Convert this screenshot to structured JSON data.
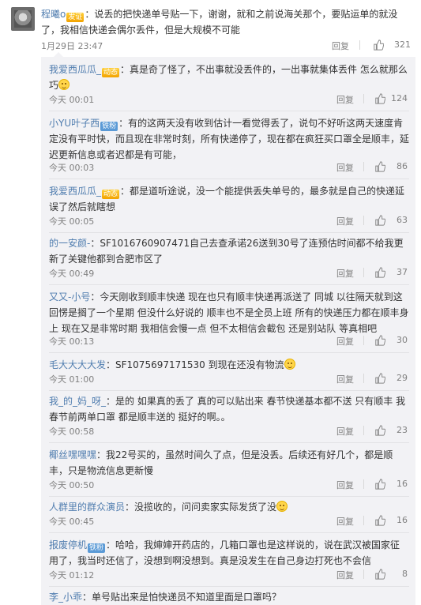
{
  "main_comment": {
    "username": "程曦o",
    "badge": "发证",
    "text": "：说丢的把快递单号贴一下，谢谢，就和之前说海关那个，要贴运单的就没了，我相信快递会偶尔丢件，但是大规模不可能",
    "time": "1月29日 23:47",
    "reply_label": "回复",
    "likes": "321"
  },
  "replies": [
    {
      "username": "我爱西瓜瓜_",
      "badge": "动态",
      "badge_type": "gold",
      "text": "：真是奇了怪了，不出事就没丢件的，一出事就集体丢件 怎么就那么巧",
      "emoji": true,
      "time": "今天 00:01",
      "reply_label": "回复",
      "likes": "124"
    },
    {
      "username": "小YU叶子西",
      "badge": "铁粉",
      "badge_type": "blue",
      "text": "：有的这两天没有收到估计一看觉得丢了，说句不好听这两天速度肯定没有平时快，而且现在非常时刻，所有快递停了，现在都在疯狂买口罩全是顺丰，延迟更新信息或者迟都是有可能，",
      "emoji": false,
      "time": "今天 00:03",
      "reply_label": "回复",
      "likes": "86"
    },
    {
      "username": "我爱西瓜瓜_",
      "badge": "动态",
      "badge_type": "gold",
      "text": "：都是道听途说，没一个能提供丢失单号的，最多就是自己的快递延误了然后就瞎想",
      "emoji": false,
      "time": "今天 00:05",
      "reply_label": "回复",
      "likes": "63"
    },
    {
      "username": "的一安颜-",
      "badge": "",
      "badge_type": "",
      "text": "：SF1016760907471自己去查承诺26送到30号了连预估时间都不给我更新了关键他都到合肥市区了",
      "emoji": false,
      "time": "今天 00:49",
      "reply_label": "回复",
      "likes": "37"
    },
    {
      "username": "又又-小号",
      "badge": "",
      "badge_type": "",
      "text": "：今天刚收到顺丰快递 现在也只有顺丰快递再派送了 同城 以往隔天就到这回愣是搁了一个星期 但没什么好说的 顺丰也不是全员上班 所有的快递压力都在顺丰身上 现在又是非常时期 我相信会慢一点 但不太相信会截包 还是别站队 等真相吧",
      "emoji": false,
      "time": "今天 00:13",
      "reply_label": "回复",
      "likes": "30"
    },
    {
      "username": "毛大大大大发",
      "badge": "",
      "badge_type": "",
      "text": "：SF1075697171530 到现在还没有物流",
      "emoji": true,
      "time": "今天 01:00",
      "reply_label": "回复",
      "likes": "29"
    },
    {
      "username": "我_的_妈_呀_",
      "badge": "",
      "badge_type": "",
      "text": "：是的 如果真的丢了 真的可以贴出来 春节快递基本都不送 只有顺丰 我春节前两单口罩 都是顺丰送的 挺好的啊。。",
      "emoji": false,
      "time": "今天 00:58",
      "reply_label": "回复",
      "likes": "23"
    },
    {
      "username": "椰丝嘿嘿嘿",
      "badge": "",
      "badge_type": "",
      "text": "：我22号买的，虽然时间久了点，但是没丢。后续还有好几个，都是顺丰，只是物流信息更新慢",
      "emoji": false,
      "time": "今天 00:50",
      "reply_label": "回复",
      "likes": "16"
    },
    {
      "username": "人群里的群众演员",
      "badge": "",
      "badge_type": "",
      "text": "：没揽收的，问问卖家实际发货了没",
      "emoji": true,
      "time": "今天 00:45",
      "reply_label": "回复",
      "likes": "16"
    },
    {
      "username": "报废停机",
      "badge": "铁粉",
      "badge_type": "blue",
      "text": "：哈哈，我婶婶开药店的，几箱口罩也是这样说的，说在武汉被国家征用了，我当时还信了，没想到啊没想到。真是没发生在自己身边打死也不会信",
      "emoji": false,
      "time": "今天 01:12",
      "reply_label": "回复",
      "likes": "8"
    },
    {
      "username": "李_小乖",
      "badge": "",
      "badge_type": "",
      "text": "：单号贴出来是怕快递员不知道里面是口罩吗？",
      "emoji": false,
      "time": "",
      "reply_label": "",
      "likes": ""
    }
  ],
  "colors": {
    "username": "#507daf",
    "reply_bg": "#f2f2f5",
    "meta": "#808080"
  }
}
